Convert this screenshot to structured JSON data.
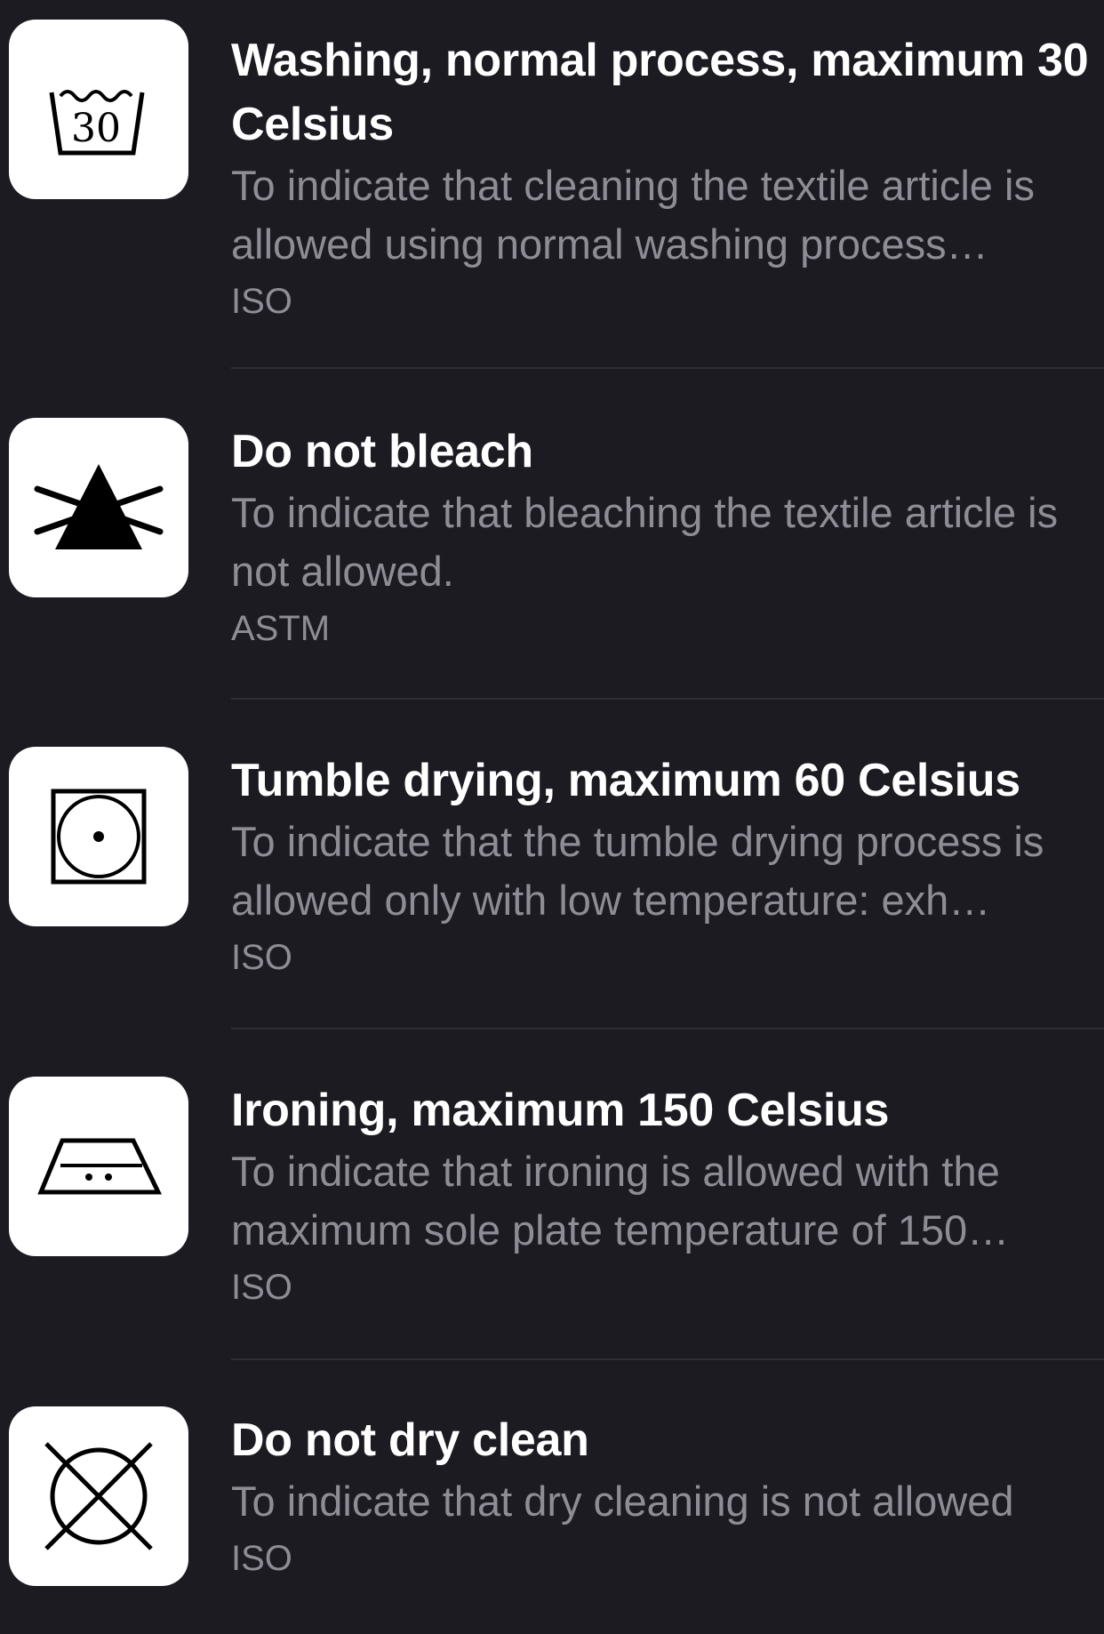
{
  "colors": {
    "background": "#1c1b22",
    "title": "#ffffff",
    "secondary": "#8e8d95",
    "separator": "#2f2e36",
    "icon_tile": "#ffffff"
  },
  "items": [
    {
      "icon": "wash-30-icon",
      "icon_text": "30",
      "title": "Washing, normal process, maximum 30 Celsius",
      "description": "To indicate that cleaning the textile article is allowed using normal washing process…",
      "source": "ISO"
    },
    {
      "icon": "do-not-bleach-icon",
      "title": "Do not bleach",
      "description": "To indicate that bleaching the textile article is not allowed.",
      "source": "ASTM"
    },
    {
      "icon": "tumble-dry-low-icon",
      "title": "Tumble drying, maximum 60 Celsius",
      "description": "To indicate that the tumble drying process is allowed only with low temperature: exh…",
      "source": "ISO"
    },
    {
      "icon": "iron-150-icon",
      "title": "Ironing, maximum 150 Celsius",
      "description": "To indicate that ironing is allowed with the maximum sole plate temperature of 150…",
      "source": "ISO"
    },
    {
      "icon": "do-not-dry-clean-icon",
      "title": "Do not dry clean",
      "description": "To indicate that dry cleaning is not allowed",
      "source": "ISO"
    }
  ]
}
